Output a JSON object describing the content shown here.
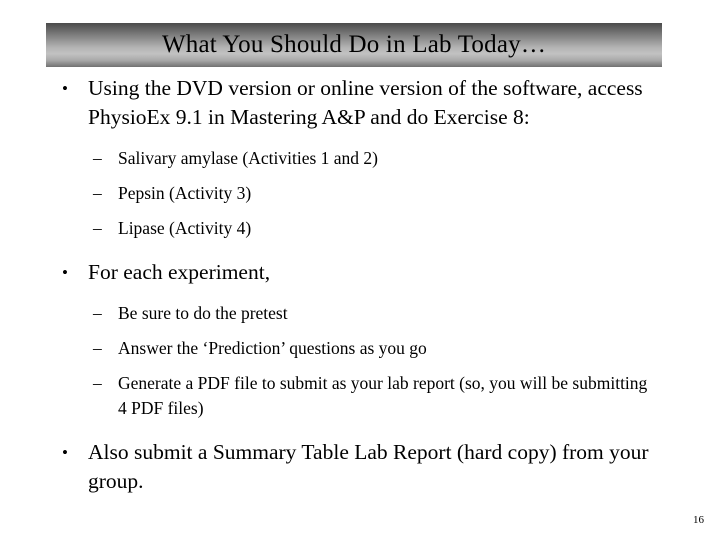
{
  "slide": {
    "title": "What You Should Do in Lab Today…",
    "page_number": "16",
    "background_color": "#ffffff",
    "text_color": "#000000",
    "title_gradient_top": "#4b4b4b",
    "title_gradient_mid": "#c2c2c2",
    "title_gradient_bottom": "#717171",
    "bullet_marker_level1": "•",
    "bullet_marker_level2": "–",
    "content": [
      {
        "level": 1,
        "text": "Using the DVD version or online version of the software, access PhysioEx 9.1 in Mastering A&P and do Exercise 8:"
      },
      {
        "level": 2,
        "text": "Salivary amylase (Activities 1 and 2)"
      },
      {
        "level": 2,
        "text": "Pepsin (Activity 3)"
      },
      {
        "level": 2,
        "text": "Lipase (Activity 4)"
      },
      {
        "level": 1,
        "text": "For each experiment,"
      },
      {
        "level": 2,
        "text": "Be sure to do the pretest"
      },
      {
        "level": 2,
        "text": "Answer the ‘Prediction’ questions as you go"
      },
      {
        "level": 2,
        "text": "Generate a PDF file to submit as your lab report (so, you will be submitting 4 PDF files)"
      },
      {
        "level": 1,
        "text": "Also submit a Summary Table Lab Report (hard copy) from your group."
      }
    ]
  }
}
